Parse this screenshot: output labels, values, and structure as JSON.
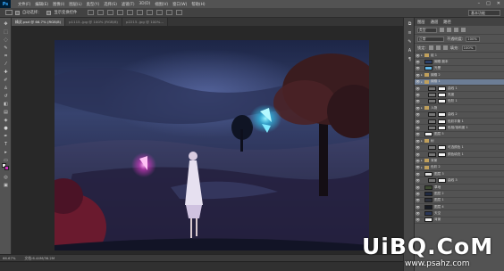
{
  "menubar": {
    "logo": "Ps",
    "items": [
      "文件(F)",
      "编辑(E)",
      "图像(I)",
      "图层(L)",
      "类型(Y)",
      "选择(S)",
      "滤镜(T)",
      "3D(D)",
      "视图(V)",
      "窗口(W)",
      "帮助(H)"
    ],
    "min": "–",
    "max": "□",
    "close": "✕"
  },
  "options": {
    "auto_select_label": "自动选择：",
    "show_transform_label": "显示变换控件",
    "workspace": "基本功能"
  },
  "tabs": [
    {
      "label": "精灵.psd @ 66.7% (RGB/8)",
      "active": true
    },
    {
      "label": "p1115..jpg @ 100% (RGB/8)",
      "active": false
    },
    {
      "label": "p2215..jpg @ 100%...",
      "active": false
    }
  ],
  "status": {
    "zoom": "66.67%",
    "doc": "文档:6.44M/36.2M"
  },
  "layers_panel": {
    "tabs": [
      "图层",
      "通道",
      "路径"
    ],
    "filter_label": "类型",
    "blend_mode": "正常",
    "opacity_label": "不透明度:",
    "opacity_value": "100%",
    "lock_label": "锁定:",
    "fill_label": "填充:",
    "fill_value": "100%",
    "layers": [
      {
        "name": "组 1",
        "kind": "group",
        "selected": false
      },
      {
        "name": "蝴蝶 副本",
        "kind": "thumb",
        "color": "#2c3f66",
        "selected": false
      },
      {
        "name": "光晕",
        "kind": "thumb",
        "color": "#5fb6e8",
        "selected": false
      },
      {
        "name": "蝴蝶 2",
        "kind": "group",
        "selected": false
      },
      {
        "name": "蝴蝶 1",
        "kind": "group",
        "selected": true
      },
      {
        "name": "曲线 1",
        "kind": "mask",
        "selected": false
      },
      {
        "name": "亮度",
        "kind": "mask",
        "selected": false
      },
      {
        "name": "色阶 1",
        "kind": "mask",
        "selected": false
      },
      {
        "name": "人物",
        "kind": "group",
        "selected": false
      },
      {
        "name": "曲线 2",
        "kind": "mask",
        "selected": false
      },
      {
        "name": "色彩平衡 1",
        "kind": "mask",
        "selected": false
      },
      {
        "name": "色相/饱和度 1",
        "kind": "mask",
        "selected": false
      },
      {
        "name": "图层 5",
        "kind": "thumb",
        "color": "#f0f0f0",
        "selected": false
      },
      {
        "name": "树",
        "kind": "group",
        "selected": false
      },
      {
        "name": "可选颜色 1",
        "kind": "mask",
        "selected": false
      },
      {
        "name": "颜色填充 1",
        "kind": "mask",
        "selected": false
      },
      {
        "name": "背景",
        "kind": "group",
        "selected": false
      },
      {
        "name": "色彩 2",
        "kind": "group",
        "selected": false
      },
      {
        "name": "图层 3",
        "kind": "thumb",
        "color": "#dddddd",
        "selected": false
      },
      {
        "name": "曲线 3",
        "kind": "mask",
        "selected": false
      },
      {
        "name": "草地",
        "kind": "thumb",
        "color": "#3d4a32",
        "selected": false
      },
      {
        "name": "图层 2",
        "kind": "thumb",
        "color": "#1f2940",
        "selected": false
      },
      {
        "name": "图层 1",
        "kind": "thumb",
        "color": "#2b2f3a",
        "selected": false
      },
      {
        "name": "图层 4",
        "kind": "thumb",
        "color": "#171b24",
        "selected": false
      },
      {
        "name": "天空",
        "kind": "thumb",
        "color": "#2a3656",
        "selected": false
      },
      {
        "name": "背景",
        "kind": "thumb",
        "color": "#f4f4f4",
        "selected": false
      }
    ]
  },
  "watermark": {
    "main": "UiBQ.CoM",
    "sub": "www.psahz.com"
  },
  "colors": {
    "foreground": "#e7e7e7",
    "background": "#cf2fc0",
    "selection": "#6c7d95"
  }
}
